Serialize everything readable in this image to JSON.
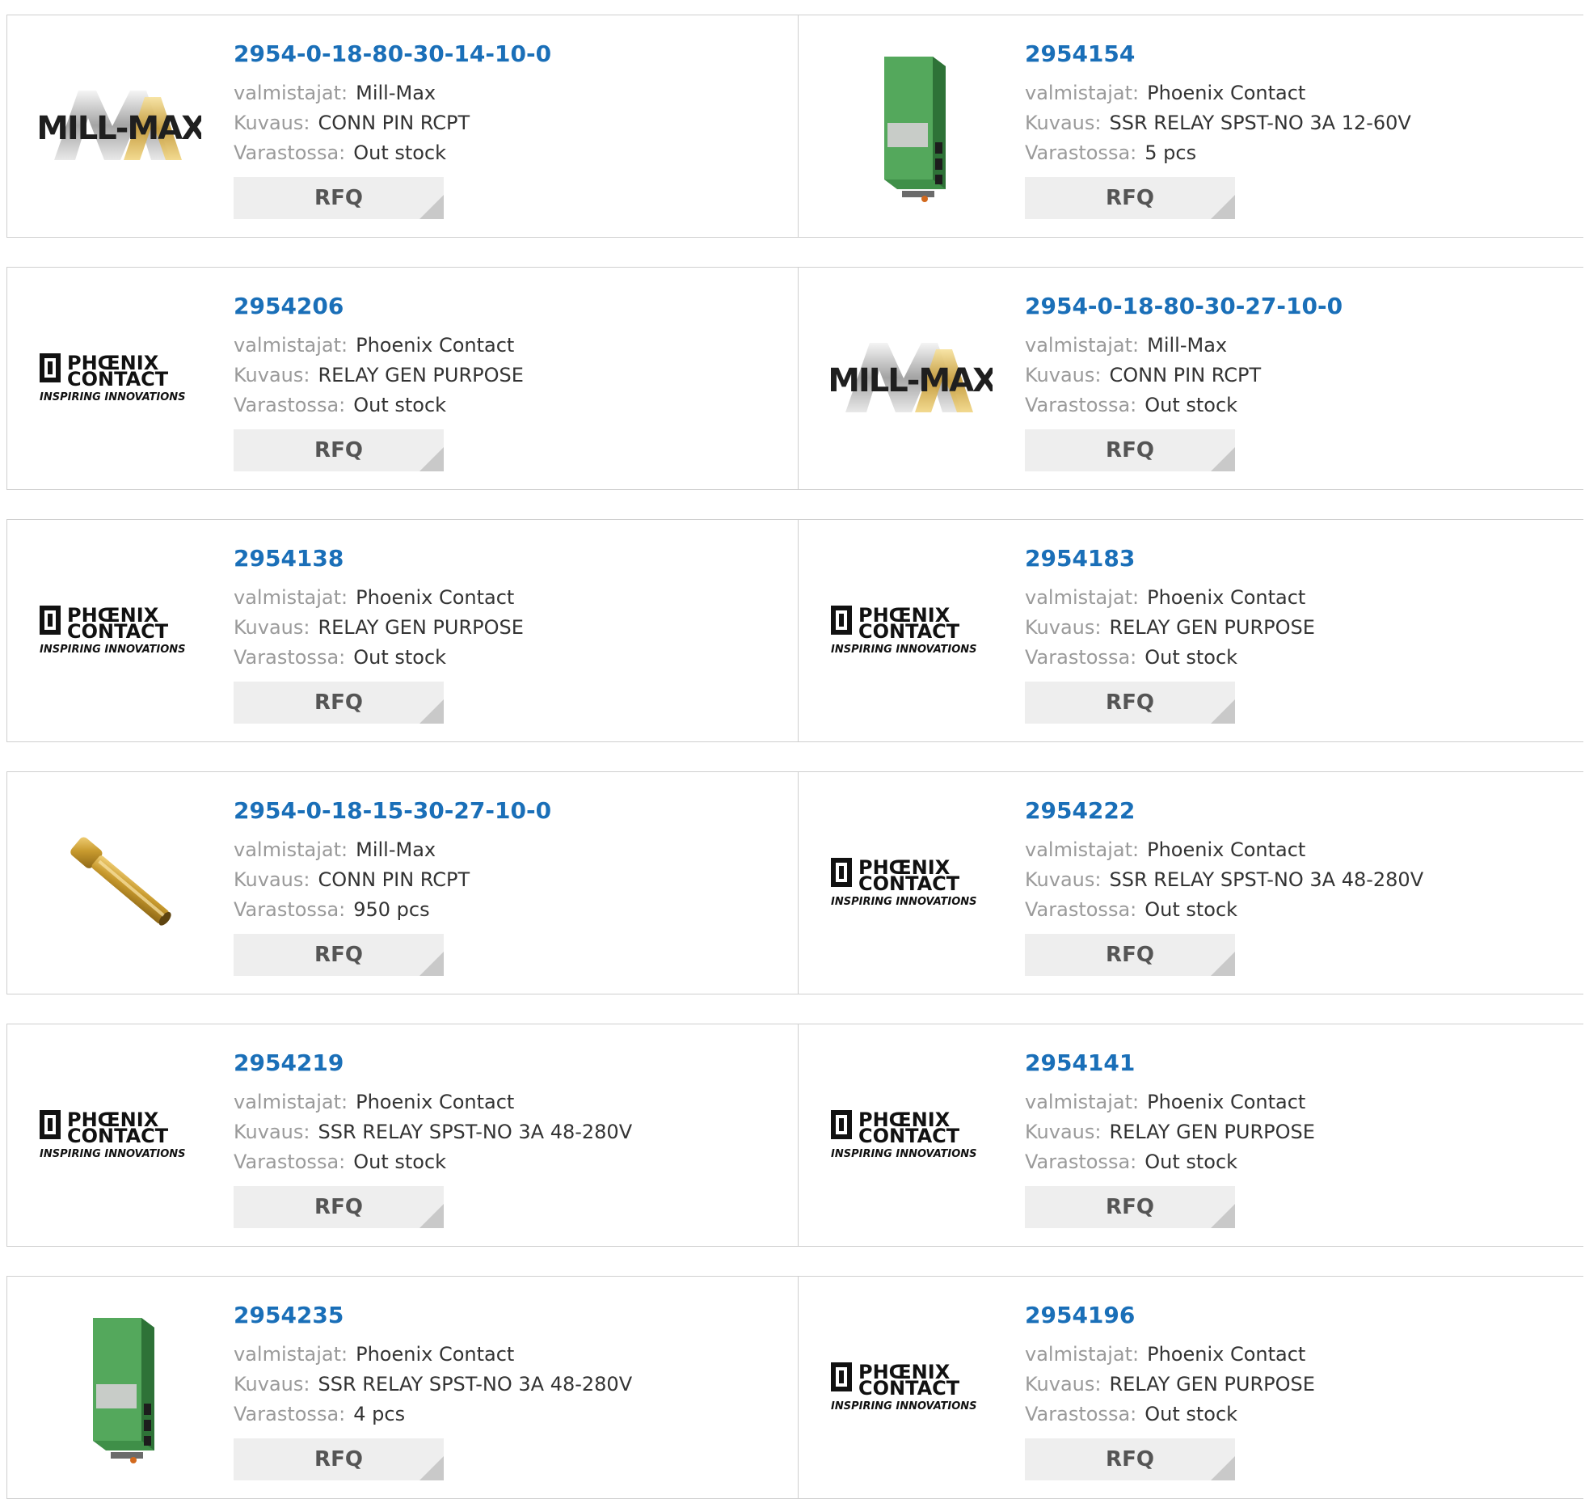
{
  "labels": {
    "manufacturer": "valmistajat:",
    "description": "Kuvaus:",
    "stock": "Varastossa:",
    "rfq": "RFQ"
  },
  "logos": {
    "millmax": "MILL-MAX",
    "phoenix_line1": "PHŒNIX",
    "phoenix_line2": "CONTACT",
    "phoenix_tagline": "INSPIRING INNOVATIONS"
  },
  "colors": {
    "link": "#1a6fb8",
    "label": "#9a9a9a",
    "value": "#333333",
    "rfq_bg": "#eeeeee",
    "card_border": "#cfcfcf"
  },
  "products": [
    {
      "part": "2954-0-18-80-30-14-10-0",
      "manufacturer": "Mill-Max",
      "description": "CONN PIN RCPT",
      "stock": "Out stock",
      "image": "millmax-logo"
    },
    {
      "part": "2954154",
      "manufacturer": "Phoenix Contact",
      "description": "SSR RELAY SPST-NO 3A 12-60V",
      "stock": "5 pcs",
      "image": "green-relay-module"
    },
    {
      "part": "2954206",
      "manufacturer": "Phoenix Contact",
      "description": "RELAY GEN PURPOSE",
      "stock": "Out stock",
      "image": "phoenix-logo"
    },
    {
      "part": "2954-0-18-80-30-27-10-0",
      "manufacturer": "Mill-Max",
      "description": "CONN PIN RCPT",
      "stock": "Out stock",
      "image": "millmax-logo"
    },
    {
      "part": "2954138",
      "manufacturer": "Phoenix Contact",
      "description": "RELAY GEN PURPOSE",
      "stock": "Out stock",
      "image": "phoenix-logo"
    },
    {
      "part": "2954183",
      "manufacturer": "Phoenix Contact",
      "description": "RELAY GEN PURPOSE",
      "stock": "Out stock",
      "image": "phoenix-logo"
    },
    {
      "part": "2954-0-18-15-30-27-10-0",
      "manufacturer": "Mill-Max",
      "description": "CONN PIN RCPT",
      "stock": "950 pcs",
      "image": "brass-pin"
    },
    {
      "part": "2954222",
      "manufacturer": "Phoenix Contact",
      "description": "SSR RELAY SPST-NO 3A 48-280V",
      "stock": "Out stock",
      "image": "phoenix-logo"
    },
    {
      "part": "2954219",
      "manufacturer": "Phoenix Contact",
      "description": "SSR RELAY SPST-NO 3A 48-280V",
      "stock": "Out stock",
      "image": "phoenix-logo"
    },
    {
      "part": "2954141",
      "manufacturer": "Phoenix Contact",
      "description": "RELAY GEN PURPOSE",
      "stock": "Out stock",
      "image": "phoenix-logo"
    },
    {
      "part": "2954235",
      "manufacturer": "Phoenix Contact",
      "description": "SSR RELAY SPST-NO 3A 48-280V",
      "stock": "4 pcs",
      "image": "green-relay-module"
    },
    {
      "part": "2954196",
      "manufacturer": "Phoenix Contact",
      "description": "RELAY GEN PURPOSE",
      "stock": "Out stock",
      "image": "phoenix-logo"
    }
  ]
}
